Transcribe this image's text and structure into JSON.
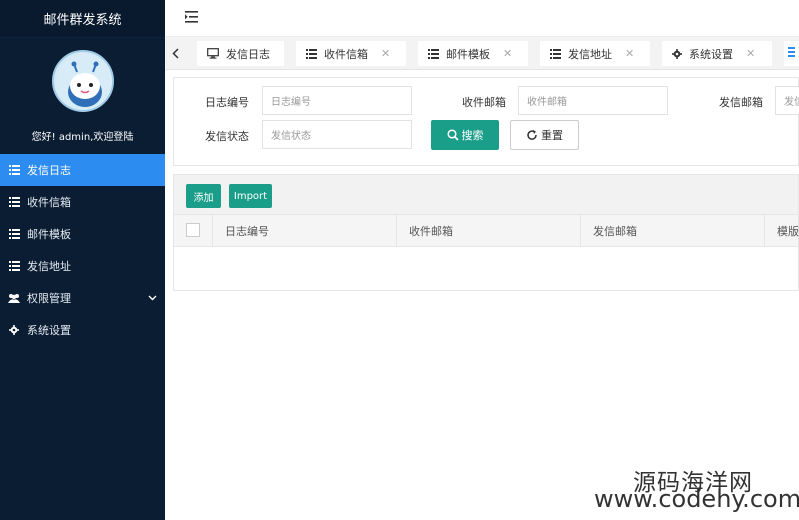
{
  "sidebar": {
    "brand": "邮件群发系统",
    "welcome": "您好! admin,欢迎登陆",
    "items": [
      {
        "label": "发信日志",
        "icon": "list-icon",
        "active": true
      },
      {
        "label": "收件信箱",
        "icon": "list-icon"
      },
      {
        "label": "邮件模板",
        "icon": "list-icon"
      },
      {
        "label": "发信地址",
        "icon": "list-icon"
      },
      {
        "label": "权限管理",
        "icon": "users-icon",
        "expandable": true
      },
      {
        "label": "系统设置",
        "icon": "gear-icon"
      }
    ]
  },
  "tabs": [
    {
      "label": "发信日志",
      "icon": "monitor-icon"
    },
    {
      "label": "收件信箱",
      "icon": "list-icon",
      "closable": true
    },
    {
      "label": "邮件模板",
      "icon": "list-icon",
      "closable": true
    },
    {
      "label": "发信地址",
      "icon": "list-icon",
      "closable": true
    },
    {
      "label": "系统设置",
      "icon": "gear-icon",
      "closable": true
    }
  ],
  "search": {
    "log_id_label": "日志编号",
    "log_id_placeholder": "日志编号",
    "recipient_label": "收件邮箱",
    "recipient_placeholder": "收件邮箱",
    "sender_label": "发信邮箱",
    "sender_placeholder": "发信",
    "status_label": "发信状态",
    "status_placeholder": "发信状态",
    "search_button": "搜索",
    "reset_button": "重置"
  },
  "table": {
    "add_button": "添加",
    "import_button": "Import",
    "columns": [
      "日志编号",
      "收件邮箱",
      "发信邮箱",
      "模版"
    ]
  },
  "watermark": {
    "line1": "源码海洋网",
    "line2": "www.codehy.com"
  },
  "colors": {
    "sidebar_bg": "#0b1d33",
    "active_item": "#2d8cf0",
    "primary_button": "#1a9e8a"
  }
}
